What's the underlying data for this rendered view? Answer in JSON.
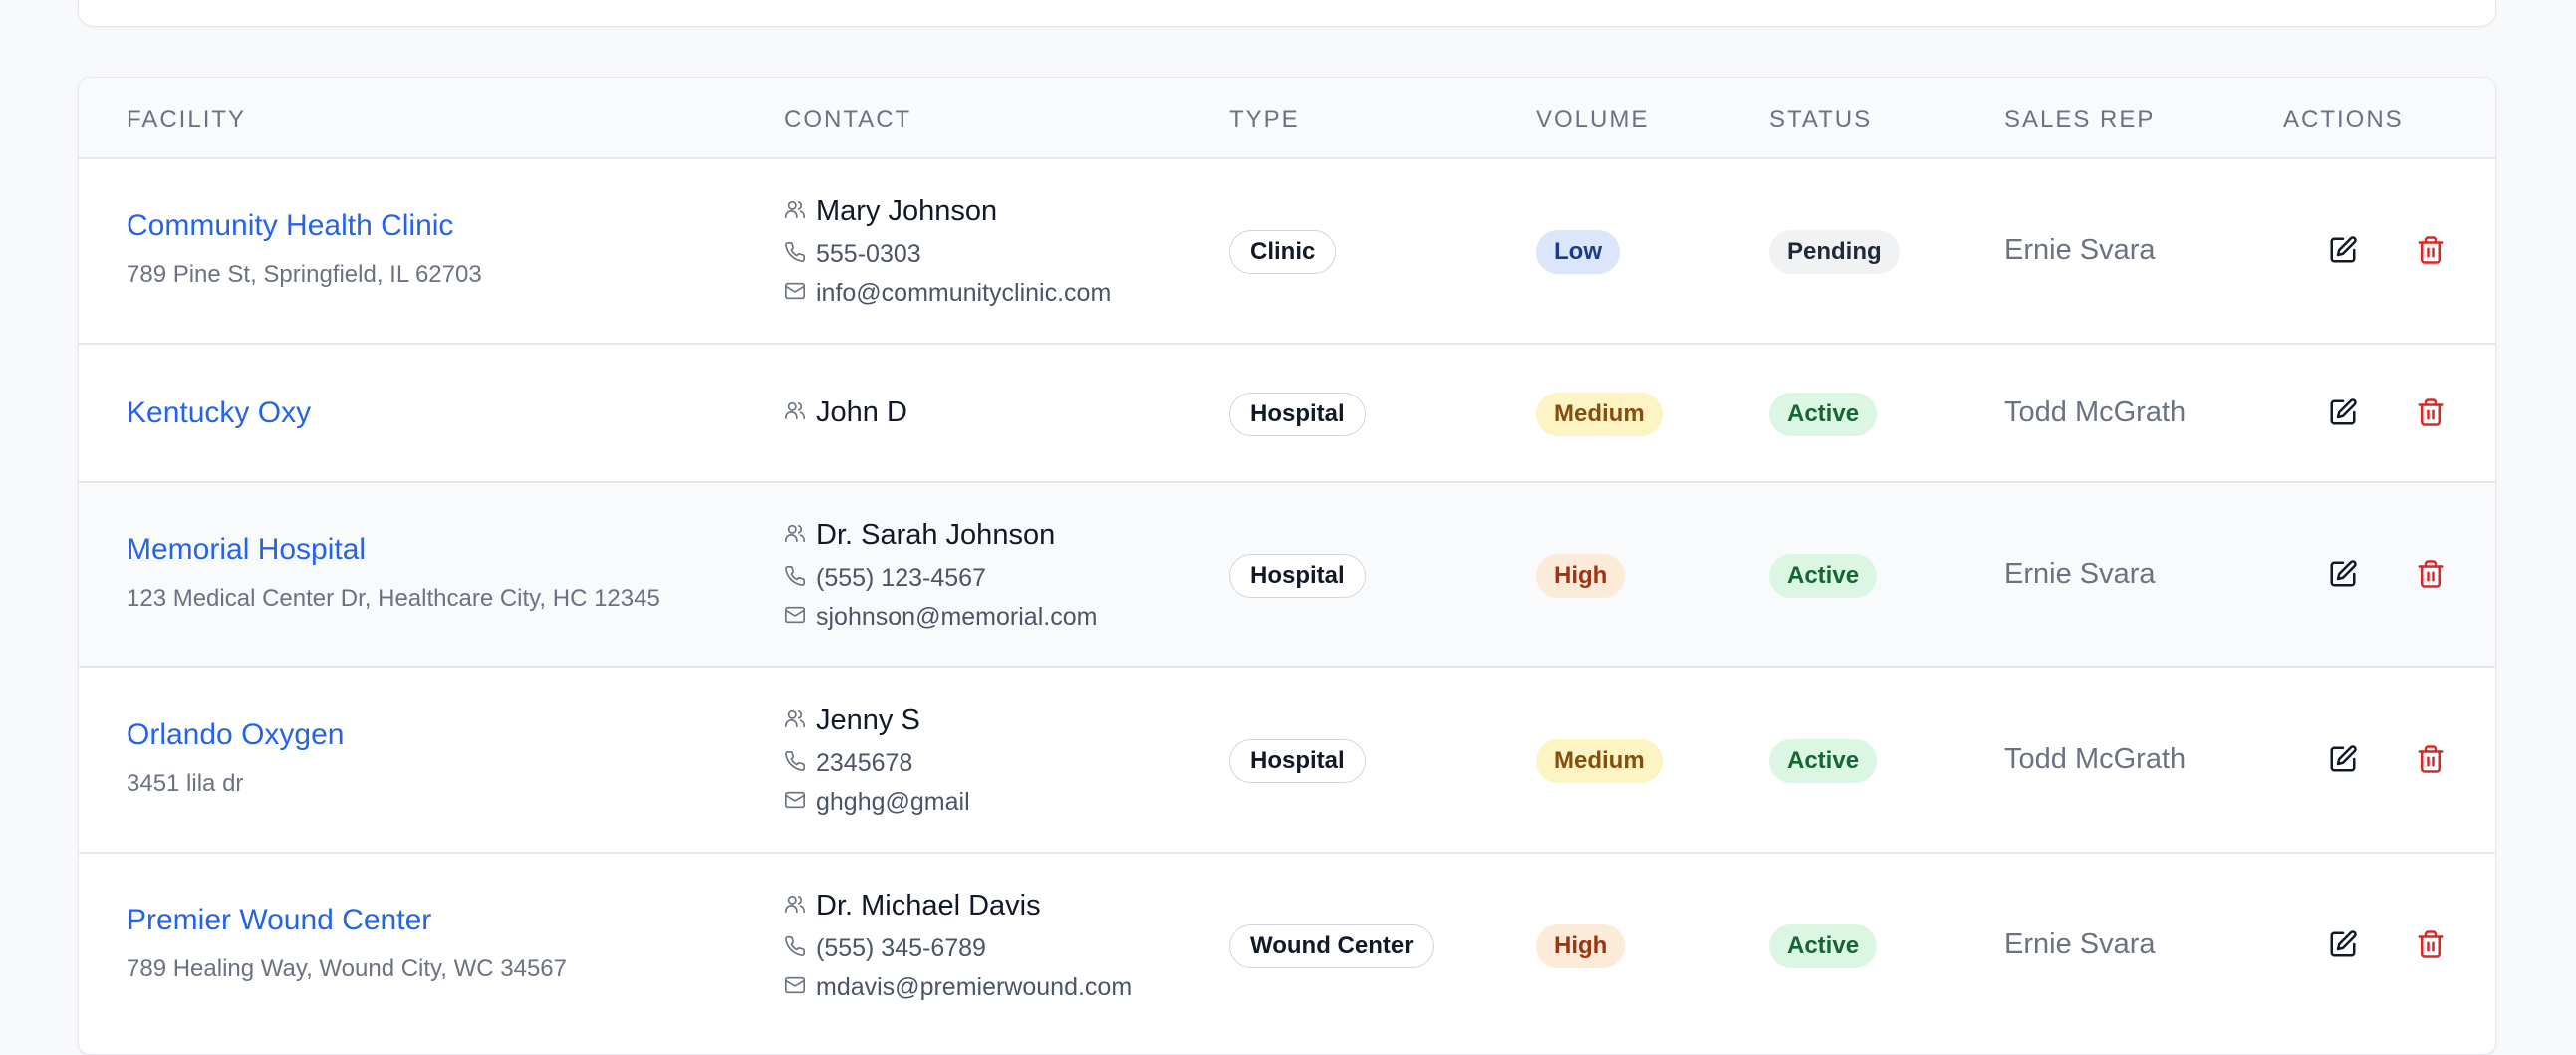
{
  "columns": [
    "FACILITY",
    "CONTACT",
    "TYPE",
    "VOLUME",
    "STATUS",
    "SALES REP",
    "ACTIONS"
  ],
  "colors": {
    "link": "#2563eb",
    "delete": "#dc2626",
    "volume_low_bg": "#dbe6fb",
    "volume_low_fg": "#1e3a8a",
    "volume_medium_bg": "#fdf4c4",
    "volume_medium_fg": "#854d0e",
    "volume_high_bg": "#fdebd9",
    "volume_high_fg": "#9a3412",
    "status_active_bg": "#dcf6e4",
    "status_active_fg": "#166534",
    "status_pending_bg": "#f1f2f4",
    "status_pending_fg": "#1f2937"
  },
  "rows": [
    {
      "facility": "Community Health Clinic",
      "address": "789 Pine St, Springfield, IL 62703",
      "contact_name": "Mary Johnson",
      "phone": "555-0303",
      "email": "info@communityclinic.com",
      "type": "Clinic",
      "volume": "Low",
      "status": "Pending",
      "sales_rep": "Ernie Svara"
    },
    {
      "facility": "Kentucky Oxy",
      "address": "",
      "contact_name": "John D",
      "phone": "",
      "email": "",
      "type": "Hospital",
      "volume": "Medium",
      "status": "Active",
      "sales_rep": "Todd McGrath"
    },
    {
      "facility": "Memorial Hospital",
      "address": "123 Medical Center Dr, Healthcare City, HC 12345",
      "contact_name": "Dr. Sarah Johnson",
      "phone": "(555) 123-4567",
      "email": "sjohnson@memorial.com",
      "type": "Hospital",
      "volume": "High",
      "status": "Active",
      "sales_rep": "Ernie Svara"
    },
    {
      "facility": "Orlando Oxygen",
      "address": "3451 lila dr",
      "contact_name": "Jenny S",
      "phone": "2345678",
      "email": "ghghg@gmail",
      "type": "Hospital",
      "volume": "Medium",
      "status": "Active",
      "sales_rep": "Todd McGrath"
    },
    {
      "facility": "Premier Wound Center",
      "address": "789 Healing Way, Wound City, WC 34567",
      "contact_name": "Dr. Michael Davis",
      "phone": "(555) 345-6789",
      "email": "mdavis@premierwound.com",
      "type": "Wound Center",
      "volume": "High",
      "status": "Active",
      "sales_rep": "Ernie Svara"
    }
  ],
  "icons": {
    "contact": "users-icon",
    "phone": "phone-icon",
    "email": "mail-icon",
    "edit": "edit-icon",
    "delete": "trash-icon"
  }
}
